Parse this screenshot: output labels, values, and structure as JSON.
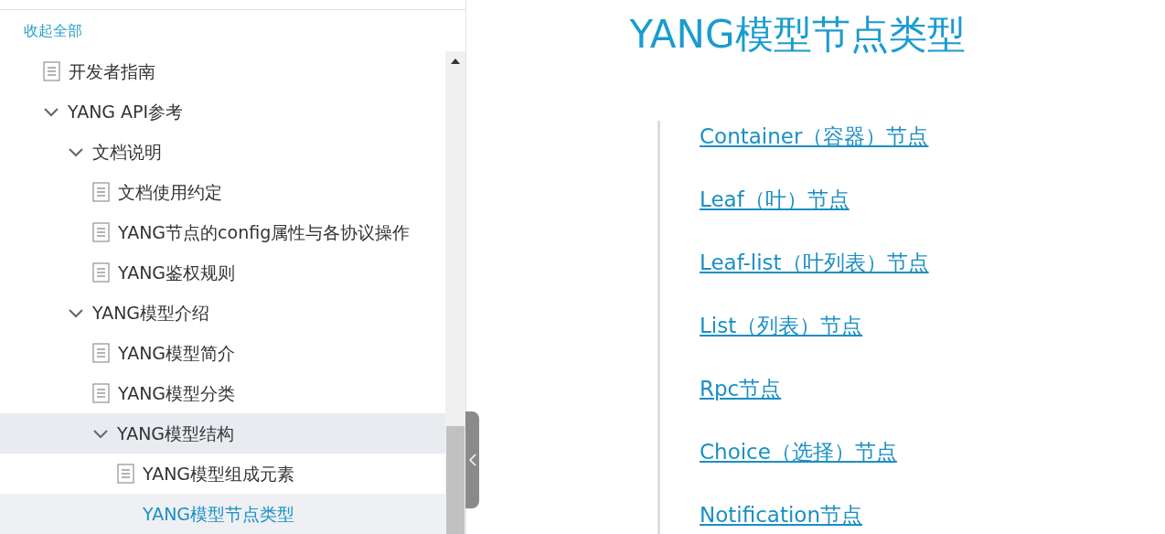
{
  "sidebar": {
    "collapse_all": "收起全部",
    "tree": [
      {
        "kind": "doc",
        "label": "开发者指南",
        "selected": false,
        "highlighted": false
      },
      {
        "kind": "folder",
        "label": "YANG API参考",
        "expanded": true,
        "selected": false,
        "highlighted": false,
        "children": [
          {
            "kind": "folder",
            "label": "文档说明",
            "expanded": true,
            "selected": false,
            "highlighted": false,
            "children": [
              {
                "kind": "doc",
                "label": "文档使用约定",
                "selected": false,
                "highlighted": false
              },
              {
                "kind": "doc",
                "label": "YANG节点的config属性与各协议操作",
                "selected": false,
                "highlighted": false
              },
              {
                "kind": "doc",
                "label": "YANG鉴权规则",
                "selected": false,
                "highlighted": false
              }
            ]
          },
          {
            "kind": "folder",
            "label": "YANG模型介绍",
            "expanded": true,
            "selected": false,
            "highlighted": false,
            "children": [
              {
                "kind": "doc",
                "label": "YANG模型简介",
                "selected": false,
                "highlighted": false
              },
              {
                "kind": "doc",
                "label": "YANG模型分类",
                "selected": false,
                "highlighted": false
              },
              {
                "kind": "folder",
                "label": "YANG模型结构",
                "expanded": true,
                "selected": false,
                "highlighted": true,
                "children": [
                  {
                    "kind": "doc",
                    "label": "YANG模型组成元素",
                    "selected": false,
                    "highlighted": false
                  },
                  {
                    "kind": "link",
                    "label": "YANG模型节点类型",
                    "selected": true,
                    "highlighted": false
                  }
                ]
              }
            ]
          }
        ]
      }
    ]
  },
  "content": {
    "title": "YANG模型节点类型",
    "links": [
      "Container（容器）节点",
      "Leaf（叶）节点",
      "Leaf-list（叶列表）节点",
      "List（列表）节点",
      "Rpc节点",
      "Choice（选择）节点",
      "Notification节点"
    ]
  }
}
